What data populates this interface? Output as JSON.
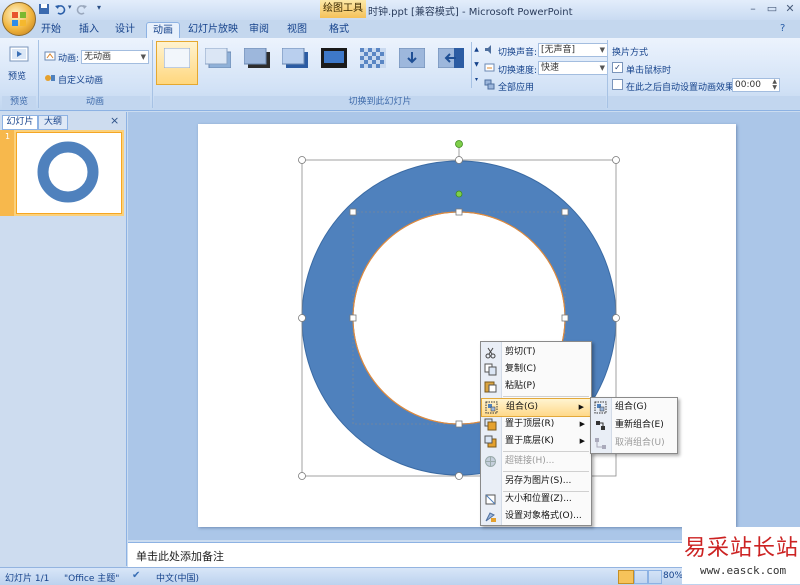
{
  "app": {
    "tool_tab": "绘图工具",
    "window_title": "时钟.ppt [兼容模式] - Microsoft PowerPoint",
    "qat_icons": [
      "save-icon",
      "undo-icon",
      "redo-icon",
      "customize-qat-icon"
    ]
  },
  "tabs": [
    {
      "label": "开始"
    },
    {
      "label": "插入"
    },
    {
      "label": "设计"
    },
    {
      "label": "动画",
      "active": true
    },
    {
      "label": "幻灯片放映"
    },
    {
      "label": "审阅"
    },
    {
      "label": "视图"
    },
    {
      "label": "格式"
    }
  ],
  "ribbon": {
    "preview": {
      "button": "预览",
      "group": "预览"
    },
    "animation": {
      "anim_label": "动画:",
      "anim_value": "无动画",
      "custom": "自定义动画",
      "group": "动画"
    },
    "transition": {
      "sound_label": "切换声音:",
      "sound_value": "[无声音]",
      "speed_label": "切换速度:",
      "speed_value": "快速",
      "apply_all": "全部应用",
      "group": "切换到此幻灯片"
    },
    "advance": {
      "title": "换片方式",
      "on_click": "单击鼠标时",
      "on_click_checked": true,
      "auto_after": "在此之后自动设置动画效果:",
      "auto_after_checked": false,
      "auto_time": "00:00"
    }
  },
  "left_pane": {
    "tabs": [
      "幻灯片",
      "大纲"
    ],
    "slide_number": "1",
    "close": "×"
  },
  "notes_placeholder": "单击此处添加备注",
  "status": {
    "slide": "幻灯片 1/1",
    "theme": "\"Office 主题\"",
    "language": "中文(中国)",
    "zoom": "80%"
  },
  "context_menu": {
    "items": [
      {
        "label": "剪切(T)",
        "icon": "cut-icon"
      },
      {
        "label": "复制(C)",
        "icon": "copy-icon"
      },
      {
        "label": "粘贴(P)",
        "icon": "paste-icon"
      },
      {
        "label": "组合(G)",
        "icon": "group-icon",
        "submenu": true,
        "highlighted": true
      },
      {
        "label": "置于顶层(R)",
        "icon": "bring-front-icon",
        "submenu": true
      },
      {
        "label": "置于底层(K)",
        "icon": "send-back-icon",
        "submenu": true
      },
      {
        "label": "超链接(H)...",
        "icon": "hyperlink-icon",
        "disabled": true
      },
      {
        "label": "另存为图片(S)..."
      },
      {
        "label": "大小和位置(Z)...",
        "icon": "size-position-icon"
      },
      {
        "label": "设置对象格式(O)...",
        "icon": "format-object-icon"
      }
    ]
  },
  "submenu": {
    "items": [
      {
        "label": "组合(G)",
        "icon": "group-icon"
      },
      {
        "label": "重新组合(E)",
        "icon": "regroup-icon"
      },
      {
        "label": "取消组合(U)",
        "icon": "ungroup-icon",
        "disabled": true
      }
    ]
  },
  "watermark": {
    "title": "易采站长站",
    "url": "www.easck.com"
  },
  "colors": {
    "ring": "#4f81bd",
    "selection_handle": "#ffffff",
    "rotate_handle": "#7fcf4a"
  }
}
